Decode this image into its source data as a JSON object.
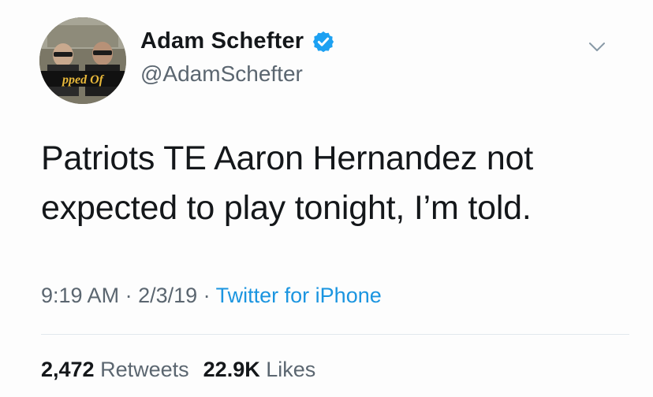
{
  "user": {
    "display_name": "Adam Schefter",
    "handle": "@AdamSchefter",
    "verified_icon": "verified-badge-icon",
    "avatar_text": "pped Of"
  },
  "tweet": {
    "text": "Patriots TE Aaron Hernandez not expected to play tonight, I’m told.",
    "time": "9:19 AM",
    "sep1": " · ",
    "date": "2/3/19",
    "sep2": " · ",
    "source": "Twitter for iPhone"
  },
  "stats": {
    "retweets_count": "2,472",
    "retweets_label": "Retweets",
    "likes_count": "22.9K",
    "likes_label": "Likes"
  },
  "colors": {
    "link": "#1b95e0",
    "secondary_text": "#5b6670",
    "primary_text": "#14171a",
    "verified": "#1da1f2"
  }
}
